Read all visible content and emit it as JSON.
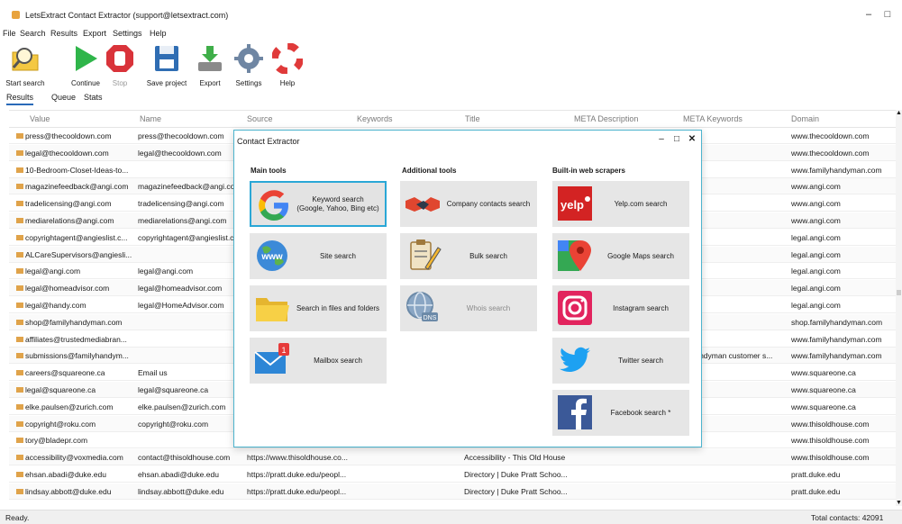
{
  "window": {
    "title": "LetsExtract Contact Extractor (support@letsextract.com)",
    "minimize": "–",
    "maximize": "□"
  },
  "menu": [
    "File",
    "Search",
    "Results",
    "Export",
    "Settings",
    "Help"
  ],
  "toolbar": {
    "start_search": "Start search",
    "continue": "Continue",
    "stop": "Stop",
    "save_project": "Save project",
    "export": "Export",
    "settings": "Settings",
    "help": "Help"
  },
  "tabs": [
    "Results",
    "Queue",
    "Stats"
  ],
  "grid": {
    "columns": [
      "Value",
      "Name",
      "Source",
      "Keywords",
      "Title",
      "META Description",
      "META Keywords",
      "Domain"
    ],
    "rows": [
      {
        "value": "press@thecooldown.com",
        "name": "press@thecooldown.com",
        "source": "",
        "title": "",
        "meta": "",
        "metakw": "",
        "domain": "www.thecooldown.com"
      },
      {
        "value": "legal@thecooldown.com",
        "name": "legal@thecooldown.com",
        "source": "",
        "title": "",
        "meta": "",
        "metakw": "",
        "domain": "www.thecooldown.com"
      },
      {
        "value": "10-Bedroom-Closet-Ideas-to...",
        "name": "",
        "source": "",
        "title": "",
        "meta": "",
        "metakw": "",
        "domain": "www.familyhandyman.com"
      },
      {
        "value": "magazinefeedback@angi.com",
        "name": "magazinefeedback@angi.co",
        "source": "",
        "title": "",
        "meta": "",
        "metakw": "",
        "domain": "www.angi.com"
      },
      {
        "value": "tradelicensing@angi.com",
        "name": "tradelicensing@angi.com",
        "source": "",
        "title": "",
        "meta": "",
        "metakw": "",
        "domain": "www.angi.com"
      },
      {
        "value": "mediarelations@angi.com",
        "name": "mediarelations@angi.com",
        "source": "",
        "title": "",
        "meta": "",
        "metakw": "",
        "domain": "www.angi.com"
      },
      {
        "value": "copyrightagent@angieslist.c...",
        "name": "copyrightagent@angieslist.c",
        "source": "",
        "title": "",
        "meta": "",
        "metakw": "",
        "domain": "legal.angi.com"
      },
      {
        "value": "ALCareSupervisors@angiesli...",
        "name": "",
        "source": "",
        "title": "",
        "meta": "",
        "metakw": "",
        "domain": "legal.angi.com"
      },
      {
        "value": "legal@angi.com",
        "name": "legal@angi.com",
        "source": "",
        "title": "",
        "meta": "",
        "metakw": "",
        "domain": "legal.angi.com"
      },
      {
        "value": "legal@homeadvisor.com",
        "name": "legal@homeadvisor.com",
        "source": "",
        "title": "",
        "meta": "",
        "metakw": "",
        "domain": "legal.angi.com"
      },
      {
        "value": "legal@handy.com",
        "name": "legal@HomeAdvisor.com",
        "source": "",
        "title": "",
        "meta": "",
        "metakw": "",
        "domain": "legal.angi.com"
      },
      {
        "value": "shop@familyhandyman.com",
        "name": "",
        "source": "",
        "title": "",
        "meta": "",
        "metakw": "",
        "domain": "shop.familyhandyman.com"
      },
      {
        "value": "affiliates@trustedmediabran...",
        "name": "",
        "source": "",
        "title": "",
        "meta": "",
        "metakw": "",
        "domain": "www.familyhandyman.com"
      },
      {
        "value": "submissions@familyhandym...",
        "name": "",
        "source": "",
        "title": "",
        "meta": "",
        "metakw": "y handyman customer s...",
        "domain": "www.familyhandyman.com"
      },
      {
        "value": "careers@squareone.ca",
        "name": "Email us",
        "source": "",
        "title": "",
        "meta": "",
        "metakw": "",
        "domain": "www.squareone.ca"
      },
      {
        "value": "legal@squareone.ca",
        "name": "legal@squareone.ca",
        "source": "",
        "title": "",
        "meta": "",
        "metakw": "",
        "domain": "www.squareone.ca"
      },
      {
        "value": "elke.paulsen@zurich.com",
        "name": "elke.paulsen@zurich.com",
        "source": "",
        "title": "",
        "meta": "",
        "metakw": "",
        "domain": "www.squareone.ca"
      },
      {
        "value": "copyright@roku.com",
        "name": "copyright@roku.com",
        "source": "",
        "title": "",
        "meta": "",
        "metakw": "",
        "domain": "www.thisoldhouse.com"
      },
      {
        "value": "tory@bladepr.com",
        "name": "",
        "source": "",
        "title": "",
        "meta": "",
        "metakw": "",
        "domain": "www.thisoldhouse.com"
      },
      {
        "value": "accessibility@voxmedia.com",
        "name": "contact@thisoldhouse.com",
        "source": "https://www.thisoldhouse.co...",
        "title": "Accessibility - This Old House",
        "meta": "",
        "metakw": "",
        "domain": "www.thisoldhouse.com"
      },
      {
        "value": "ehsan.abadi@duke.edu",
        "name": "ehsan.abadi@duke.edu",
        "source": "https://pratt.duke.edu/peopl...",
        "title": "Directory | Duke Pratt Schoo...",
        "meta": "",
        "metakw": "",
        "domain": "pratt.duke.edu"
      },
      {
        "value": "lindsay.abbott@duke.edu",
        "name": "lindsay.abbott@duke.edu",
        "source": "https://pratt.duke.edu/peopl...",
        "title": "Directory | Duke Pratt Schoo...",
        "meta": "",
        "metakw": "",
        "domain": "pratt.duke.edu"
      }
    ]
  },
  "dialog": {
    "title": "Contact Extractor",
    "minimize": "–",
    "maximize": "□",
    "close": "✕",
    "groups": {
      "main": "Main tools",
      "additional": "Additional tools",
      "scrapers": "Built-in web scrapers"
    },
    "tiles": {
      "keyword": "Keyword search\n(Google, Yahoo, Bing etc)",
      "site": "Site search",
      "files": "Search in files and folders",
      "mailbox": "Mailbox search",
      "mailbox_badge": "1",
      "company": "Company contacts search",
      "bulk": "Bulk search",
      "whois": "Whois search",
      "whois_icon_text": "DNS",
      "yelp": "Yelp.com search",
      "yelp_logo": "yelp",
      "gmaps": "Google Maps search",
      "instagram": "Instagram search",
      "twitter": "Twitter search",
      "facebook": "Facebook search *"
    }
  },
  "status": {
    "left": "Ready.",
    "right": "Total contacts: 42091"
  },
  "colors": {
    "accent": "#2aa7d6",
    "dialog_border": "#4db4ce",
    "tile_bg": "#e6e6e6"
  }
}
